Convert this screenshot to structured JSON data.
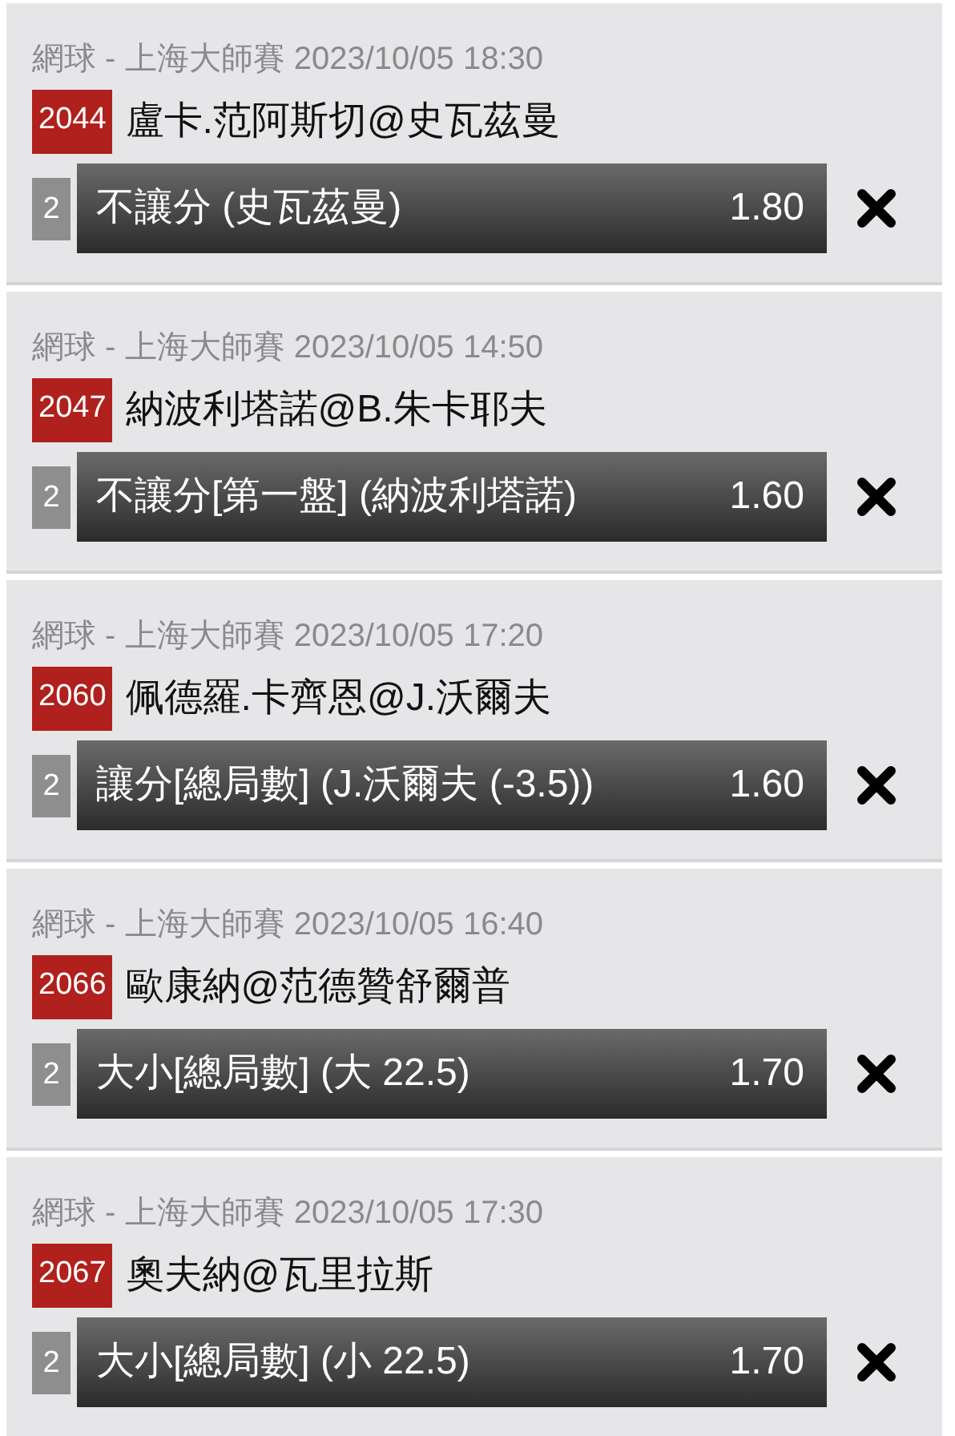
{
  "bets": [
    {
      "event": "網球 - 上海大師賽 2023/10/05 18:30",
      "code": "2044",
      "match": "盧卡.范阿斯切@史瓦茲曼",
      "count": "2",
      "selection": "不讓分 (史瓦茲曼)",
      "odds": "1.80"
    },
    {
      "event": "網球 - 上海大師賽 2023/10/05 14:50",
      "code": "2047",
      "match": "納波利塔諾@B.朱卡耶夫",
      "count": "2",
      "selection": "不讓分[第一盤] (納波利塔諾)",
      "odds": "1.60"
    },
    {
      "event": "網球 - 上海大師賽 2023/10/05 17:20",
      "code": "2060",
      "match": "佩德羅.卡齊恩@J.沃爾夫",
      "count": "2",
      "selection": "讓分[總局數] (J.沃爾夫 (-3.5))",
      "odds": "1.60"
    },
    {
      "event": "網球 - 上海大師賽 2023/10/05 16:40",
      "code": "2066",
      "match": "歐康納@范德贊舒爾普",
      "count": "2",
      "selection": "大小[總局數] (大 22.5)",
      "odds": "1.70"
    },
    {
      "event": "網球 - 上海大師賽 2023/10/05 17:30",
      "code": "2067",
      "match": "奧夫納@瓦里拉斯",
      "count": "2",
      "selection": "大小[總局數] (小 22.5)",
      "odds": "1.70"
    }
  ]
}
